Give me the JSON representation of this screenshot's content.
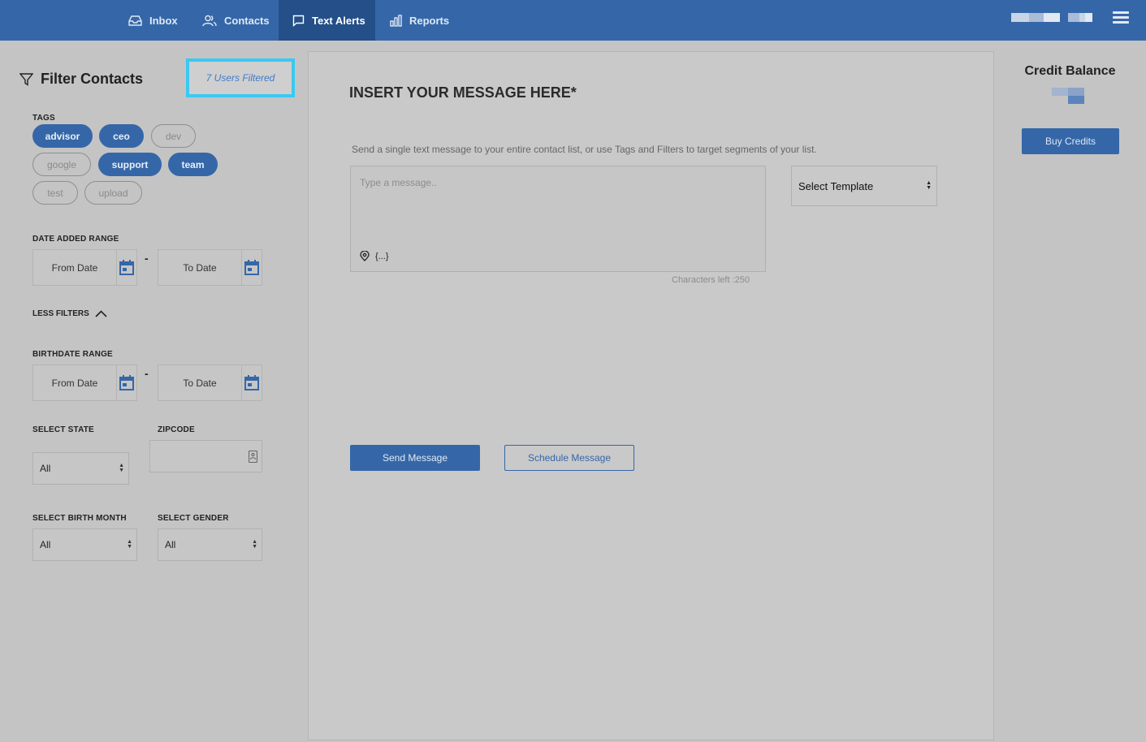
{
  "nav": {
    "items": [
      {
        "label": "Inbox",
        "icon": "inbox-icon"
      },
      {
        "label": "Contacts",
        "icon": "users-icon"
      },
      {
        "label": "Text Alerts",
        "icon": "message-icon",
        "active": true
      },
      {
        "label": "Reports",
        "icon": "bar-chart-icon"
      }
    ]
  },
  "filters": {
    "title": "Filter Contacts",
    "users_filtered": "7 Users Filtered",
    "tags_label": "TAGS",
    "tags": [
      {
        "label": "advisor",
        "selected": true
      },
      {
        "label": "ceo",
        "selected": true
      },
      {
        "label": "dev",
        "selected": false
      },
      {
        "label": "google",
        "selected": false
      },
      {
        "label": "support",
        "selected": true
      },
      {
        "label": "team",
        "selected": true
      },
      {
        "label": "test",
        "selected": false
      },
      {
        "label": "upload",
        "selected": false
      }
    ],
    "date_added_label": "DATE ADDED RANGE",
    "from_date": "From Date",
    "to_date": "To Date",
    "dash": "-",
    "less_filters": "LESS FILTERS",
    "birthdate_label": "BIRTHDATE RANGE",
    "state_label": "SELECT STATE",
    "state_value": "All",
    "zipcode_label": "ZIPCODE",
    "birth_month_label": "SELECT BIRTH MONTH",
    "birth_month_value": "All",
    "gender_label": "SELECT GENDER",
    "gender_value": "All"
  },
  "main": {
    "title": "INSERT YOUR MESSAGE HERE*",
    "description": "Send a single text message to your entire contact list, or use Tags and Filters to target segments of your list.",
    "message_placeholder": "Type a message..",
    "variable_token": "{...}",
    "chars_left": "Characters left :250",
    "template_select": "Select Template",
    "send_button": "Send Message",
    "schedule_button": "Schedule Message"
  },
  "credits": {
    "title": "Credit Balance",
    "buy_button": "Buy Credits"
  },
  "colors": {
    "brand": "#3567a8",
    "highlight": "#39c9f2"
  }
}
